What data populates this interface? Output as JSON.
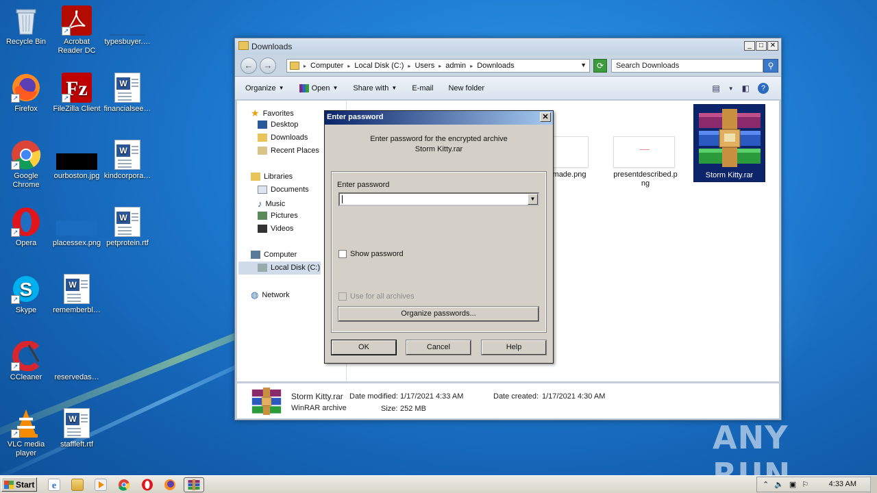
{
  "desktop": {
    "icons": [
      {
        "label": "Recycle Bin",
        "icon": "recycle-bin-icon"
      },
      {
        "label": "Acrobat\nReader DC",
        "icon": "acrobat-icon"
      },
      {
        "label": "typesbuyer.…",
        "icon": "blank-file-icon"
      },
      {
        "label": "Firefox",
        "icon": "firefox-icon"
      },
      {
        "label": "FileZilla Client",
        "icon": "filezilla-icon"
      },
      {
        "label": "financialsee…",
        "icon": "word-doc-icon"
      },
      {
        "label": "Google\nChrome",
        "icon": "chrome-icon"
      },
      {
        "label": "ourboston.jpg",
        "icon": "image-file-icon"
      },
      {
        "label": "kindcorpora…",
        "icon": "word-doc-icon"
      },
      {
        "label": "Opera",
        "icon": "opera-icon"
      },
      {
        "label": "placessex.png",
        "icon": "image-file-icon"
      },
      {
        "label": "petprotein.rtf",
        "icon": "word-doc-icon"
      },
      {
        "label": "Skype",
        "icon": "skype-icon"
      },
      {
        "label": "rememberbl…",
        "icon": "word-doc-icon"
      },
      {
        "label": "CCleaner",
        "icon": "ccleaner-icon"
      },
      {
        "label": "reservedas…",
        "icon": "blank-file-icon"
      },
      {
        "label": "VLC media\nplayer",
        "icon": "vlc-icon"
      },
      {
        "label": "staffleft.rtf",
        "icon": "word-doc-icon"
      }
    ]
  },
  "explorer": {
    "title": "Downloads",
    "breadcrumb": [
      "Computer",
      "Local Disk (C:)",
      "Users",
      "admin",
      "Downloads"
    ],
    "search_placeholder": "Search Downloads",
    "toolbar": {
      "organize": "Organize",
      "open": "Open",
      "share_with": "Share with",
      "email": "E-mail",
      "new_folder": "New folder"
    },
    "nav": {
      "favorites": "Favorites",
      "desktop": "Desktop",
      "downloads": "Downloads",
      "recent_places": "Recent Places",
      "libraries": "Libraries",
      "documents": "Documents",
      "music": "Music",
      "pictures": "Pictures",
      "videos": "Videos",
      "computer": "Computer",
      "local_disk": "Local Disk (C:)",
      "network": "Network"
    },
    "files": {
      "made_png": "made.png",
      "presentdescribed": "presentdescribed.p\nng",
      "storm_kitty": "Storm Kitty.rar"
    },
    "details": {
      "name": "Storm Kitty.rar",
      "type": "WinRAR archive",
      "date_modified_label": "Date modified:",
      "date_modified": "1/17/2021 4:33 AM",
      "size_label": "Size:",
      "size": "252 MB",
      "date_created_label": "Date created:",
      "date_created": "1/17/2021 4:30 AM"
    }
  },
  "dialog": {
    "title": "Enter password",
    "message_line1": "Enter password for the encrypted archive",
    "message_line2": "Storm Kitty.rar",
    "password_label": "Enter password",
    "password_value": "",
    "show_password": "Show password",
    "use_for_all": "Use for all archives",
    "organize_passwords": "Organize passwords...",
    "ok": "OK",
    "cancel": "Cancel",
    "help": "Help"
  },
  "taskbar": {
    "start": "Start",
    "clock": "4:33 AM"
  },
  "watermark": "ANY RUN",
  "colors": {
    "desktop_bg": "#1f7dd3",
    "dialog_title": "#0a246a",
    "selection": "#0b246a"
  }
}
